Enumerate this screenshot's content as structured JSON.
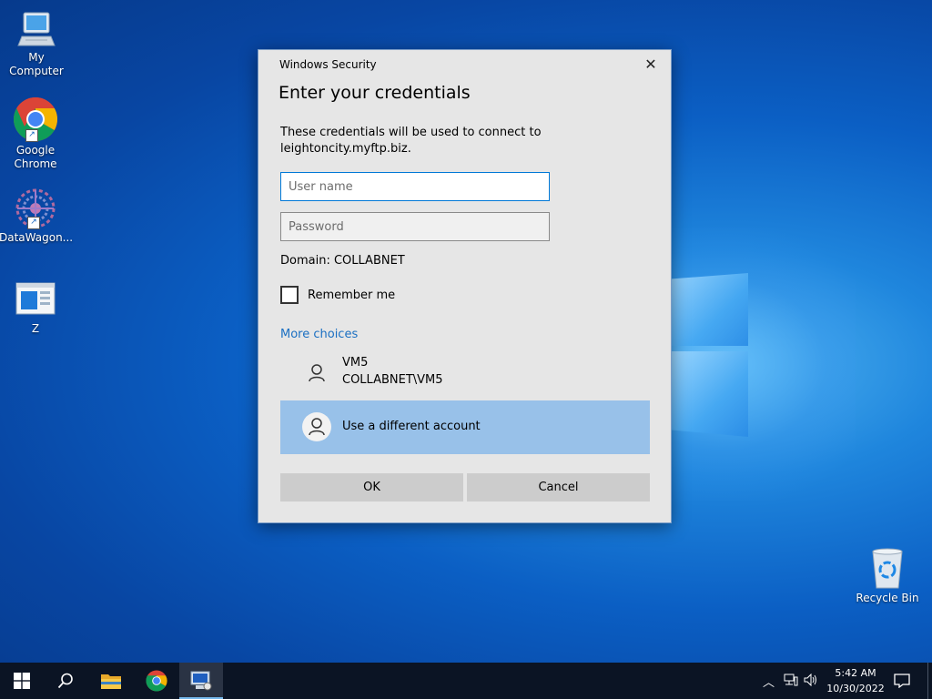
{
  "desktop": {
    "icons": [
      {
        "label": "My Computer"
      },
      {
        "label": "Google Chrome"
      },
      {
        "label": "DataWagon..."
      },
      {
        "label": "Z"
      },
      {
        "label": "Recycle Bin"
      }
    ]
  },
  "dialog": {
    "window_title": "Windows Security",
    "heading": "Enter your credentials",
    "message": "These credentials will be used to connect to leightoncity.myftp.biz.",
    "username": {
      "value": "",
      "placeholder": "User name"
    },
    "password": {
      "value": "",
      "placeholder": "Password"
    },
    "domain": "Domain: COLLABNET",
    "remember_label": "Remember me",
    "remember_checked": false,
    "more_choices": "More choices",
    "accounts": [
      {
        "name": "VM5",
        "detail": "COLLABNET\\VM5",
        "selected": false
      },
      {
        "name": "Use a different account",
        "selected": true
      }
    ],
    "ok_label": "OK",
    "cancel_label": "Cancel"
  },
  "taskbar": {
    "apps": [
      {
        "name": "start",
        "icon": "windows-logo-icon"
      },
      {
        "name": "search",
        "icon": "search-icon"
      },
      {
        "name": "file-explorer",
        "icon": "folder-icon"
      },
      {
        "name": "chrome",
        "icon": "chrome-icon"
      },
      {
        "name": "credential-manager",
        "icon": "credential-app-icon",
        "active": true
      }
    ],
    "clock": {
      "time": "5:42 AM",
      "date": "10/30/2022"
    }
  },
  "colors": {
    "accent": "#0078d7",
    "link": "#1a6fc2",
    "selected_account": "#98c1e9",
    "dialog_bg": "#e6e6e6",
    "button_bg": "#cccccc"
  }
}
